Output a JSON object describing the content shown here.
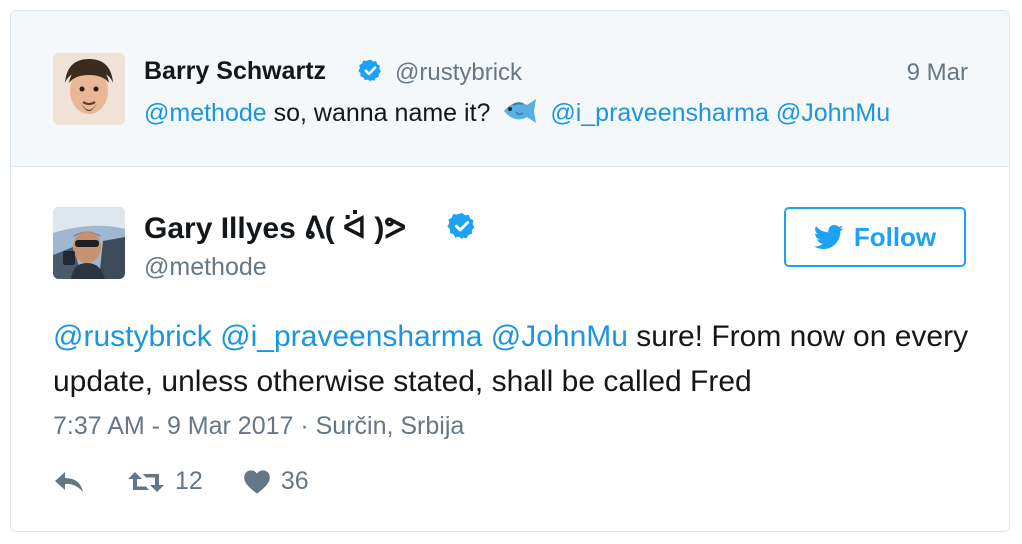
{
  "parent_tweet": {
    "author_name": "Barry Schwartz",
    "handle": "@rustybrick",
    "date": "9 Mar",
    "mention_1": "@methode",
    "text": "so, wanna name it?",
    "emoji": "fish-icon",
    "mention_2": "@i_praveensharma",
    "mention_3": "@JohnMu"
  },
  "main_tweet": {
    "author_name": "Gary Illyes ᕕ( ᐛ )ᕗ",
    "handle": "@methode",
    "follow_label": "Follow",
    "mention_1": "@rustybrick",
    "mention_2": "@i_praveensharma",
    "mention_3": "@JohnMu",
    "text": "sure! From now on every update, unless otherwise stated, shall be called Fred",
    "timestamp": "7:37 AM - 9 Mar 2017 · Surčin, Srbija",
    "retweet_count": "12",
    "like_count": "36"
  },
  "colors": {
    "link": "#1b95e0",
    "muted": "#657786",
    "brand": "#1da1f2",
    "border": "#e1e8ed"
  }
}
